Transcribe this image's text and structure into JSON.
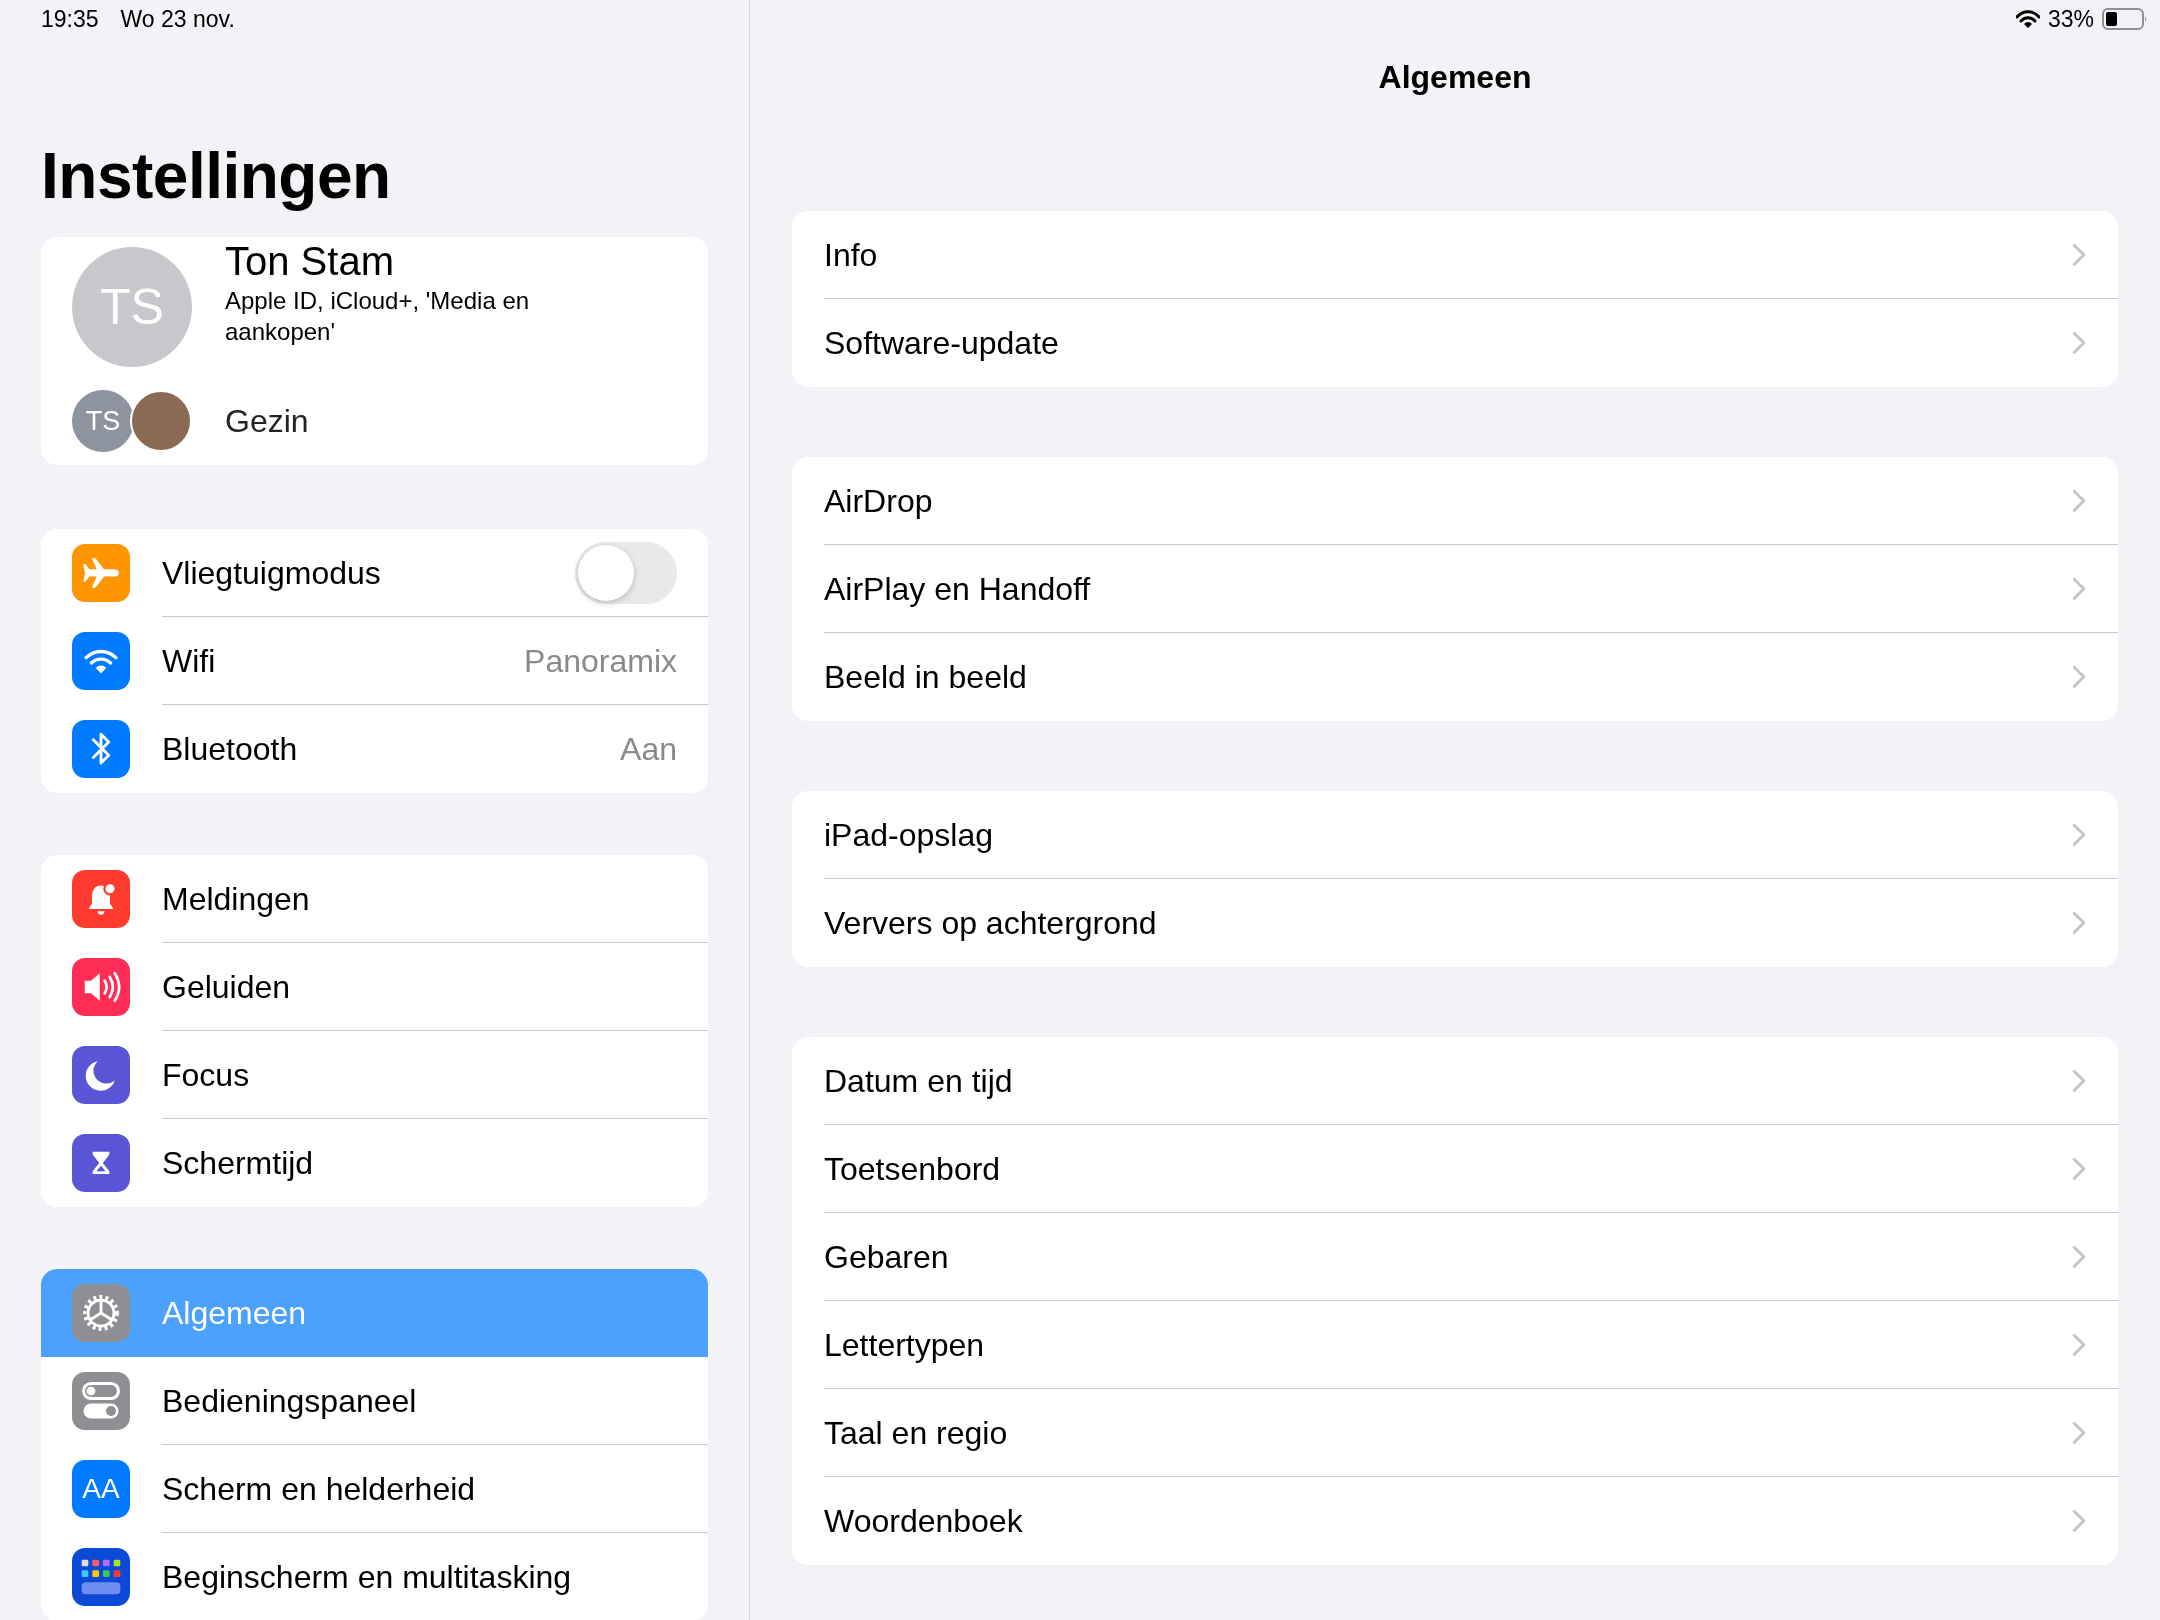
{
  "status_bar": {
    "time": "19:35",
    "date": "Wo 23 nov.",
    "battery": "33%"
  },
  "sidebar": {
    "title": "Instellingen",
    "profile": {
      "initials": "TS",
      "name": "Ton Stam",
      "subtitle": "Apple ID, iCloud+, 'Media en aankopen'"
    },
    "family": {
      "initials": "TS",
      "label": "Gezin"
    },
    "groups": [
      {
        "items": [
          {
            "kind": "toggle",
            "label": "Vliegtuigmodus",
            "on": false,
            "color": "#ff9500",
            "selected": false
          },
          {
            "kind": "value",
            "label": "Wifi",
            "value": "Panoramix",
            "color": "#007aff",
            "selected": false
          },
          {
            "kind": "value",
            "label": "Bluetooth",
            "value": "Aan",
            "color": "#007aff",
            "selected": false
          }
        ]
      },
      {
        "items": [
          {
            "kind": "plain",
            "label": "Meldingen",
            "color": "#ff3b30",
            "selected": false
          },
          {
            "kind": "plain",
            "label": "Geluiden",
            "color": "#ff2d55",
            "selected": false
          },
          {
            "kind": "plain",
            "label": "Focus",
            "color": "#5856d6",
            "selected": false
          },
          {
            "kind": "plain",
            "label": "Schermtijd",
            "color": "#5856d6",
            "selected": false
          }
        ]
      },
      {
        "items": [
          {
            "kind": "plain",
            "label": "Algemeen",
            "color": "#8e8e93",
            "selected": true
          },
          {
            "kind": "plain",
            "label": "Bedieningspaneel",
            "color": "#8e8e93",
            "selected": false
          },
          {
            "kind": "plain",
            "label": "Scherm en helderheid",
            "color": "#007aff",
            "icon_text": "AA",
            "selected": false
          },
          {
            "kind": "plain",
            "label": "Beginscherm en multitasking",
            "color": "#0b49d6",
            "selected": false
          }
        ]
      }
    ]
  },
  "detail": {
    "title": "Algemeen",
    "groups": [
      {
        "items": [
          "Info",
          "Software-update"
        ]
      },
      {
        "items": [
          "AirDrop",
          "AirPlay en Handoff",
          "Beeld in beeld"
        ]
      },
      {
        "items": [
          "iPad-opslag",
          "Ververs op achtergrond"
        ]
      },
      {
        "items": [
          "Datum en tijd",
          "Toetsenbord",
          "Gebaren",
          "Lettertypen",
          "Taal en regio",
          "Woordenboek"
        ]
      }
    ]
  }
}
